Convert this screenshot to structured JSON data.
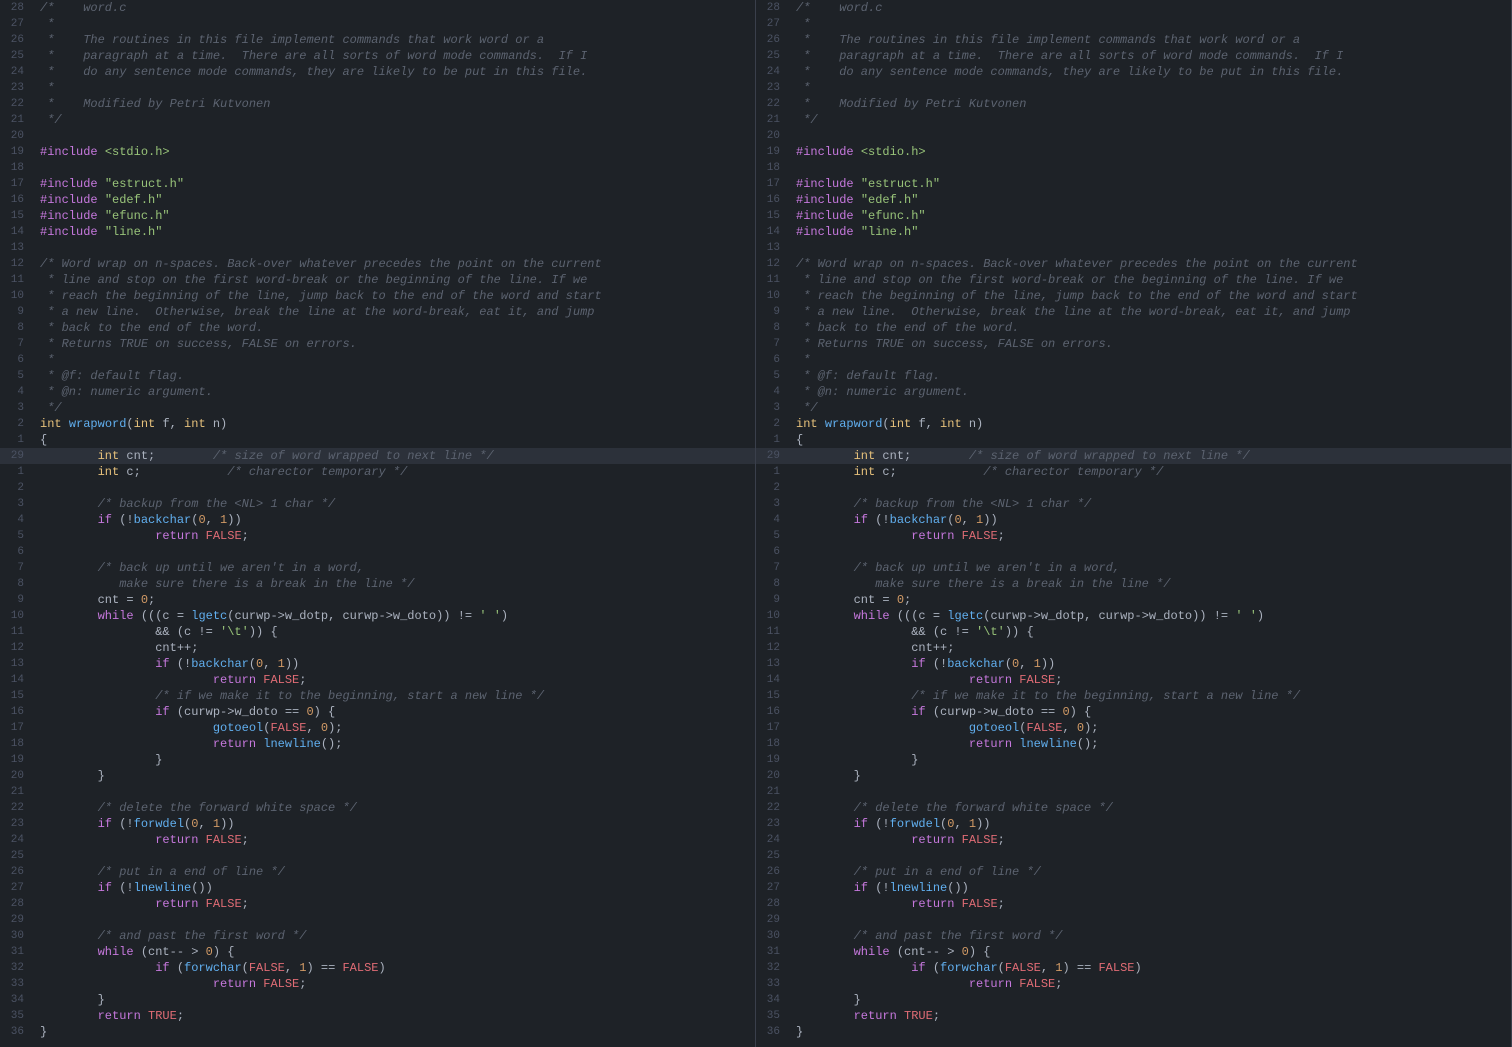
{
  "panes": [
    {
      "id": "left"
    },
    {
      "id": "right"
    }
  ],
  "colors": {
    "bg": "#1e2227",
    "highlight": "#2c313a",
    "linenum": "#4b5263",
    "comment": "#5c6370",
    "keyword": "#c678dd",
    "type": "#e5c07b",
    "string": "#98c379",
    "func": "#61afef",
    "num": "#d19a66",
    "normal": "#abb2bf",
    "var": "#e06c75"
  }
}
